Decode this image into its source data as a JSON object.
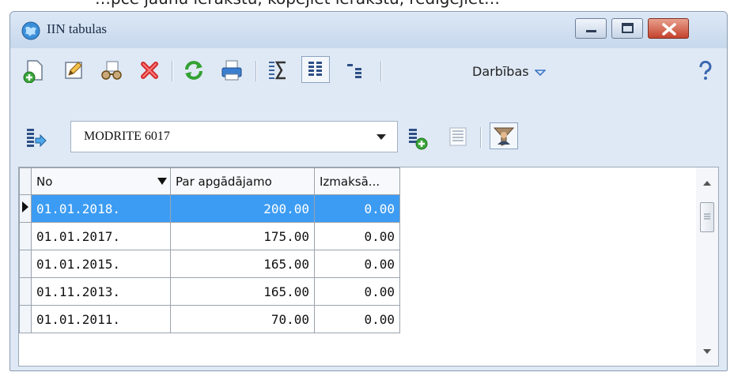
{
  "caption_fragment": "…pcē jaunu ierakstu, kopējiet ierakstu, rediģējiet…",
  "window": {
    "title": "IIN tabulas"
  },
  "toolbar": {
    "actions_label": "Darbības"
  },
  "filter": {
    "selected_value": "MODRITE 6017"
  },
  "grid": {
    "columns": [
      "No",
      "Par apgādājamo",
      "Izmaksā..."
    ],
    "rows": [
      {
        "no": "01.01.2018.",
        "dependent": "200.00",
        "paid": "0.00"
      },
      {
        "no": "01.01.2017.",
        "dependent": "175.00",
        "paid": "0.00"
      },
      {
        "no": "01.01.2015.",
        "dependent": "165.00",
        "paid": "0.00"
      },
      {
        "no": "01.11.2013.",
        "dependent": "165.00",
        "paid": "0.00"
      },
      {
        "no": "01.01.2011.",
        "dependent": "70.00",
        "paid": "0.00"
      }
    ],
    "selected_row": 0
  },
  "colors": {
    "selection": "#3c9cf4",
    "close_button": "#c4432e",
    "window_bg": "#dfe9f5"
  },
  "icons": [
    "app-globe-icon",
    "new-record-icon",
    "edit-icon",
    "copy-record-icon",
    "delete-icon",
    "refresh-icon",
    "print-icon",
    "sum-icon",
    "columns-icon",
    "tree-icon",
    "help-icon",
    "import-icon",
    "add-table-icon",
    "list-icon",
    "user-filter-icon"
  ]
}
